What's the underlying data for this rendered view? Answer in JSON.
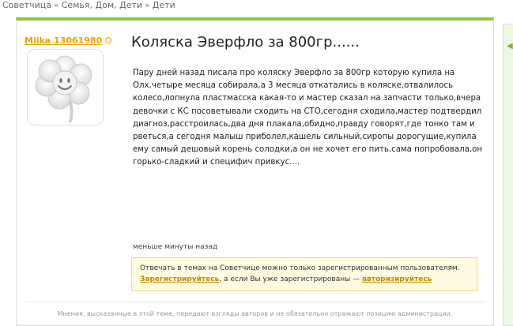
{
  "breadcrumb": {
    "items": [
      "Советчица",
      "Семья, Дом, Дети",
      "Дети"
    ],
    "separator": "»"
  },
  "post": {
    "author": "Milka 13061980",
    "title": "Коляска Эверфло за 800гр......",
    "body": "Пару дней назад писала про коляску Эверфло за 800гр которую купила на Олх,четыре месяца собирала,а 3 месяца откатались в коляске,отвалилось колесо,лопнула пластмасска какая-то и мастер сказал на запчасти только,вчера девочки с КС посоветывали сходить на СТО,сегодня сходила,мастер подтвердил диагноз,расстроилась,два дня плакала,обидно,правду говорят,где тонко там и рветься,а сегодня малыш приболел,кашель сильный,сиропы дорогущие,купила ему самый дешовый корень солодки,а он не хочет его пить,сама попробовала,он горько-сладкий и специфич привкус....",
    "time": "меньше минуты назад"
  },
  "notice": {
    "text_1": "Отвечать в темах на Советчице можно только зарегистрированным пользователям.",
    "register_link": "Зарегистрируйтесь",
    "text_2": ", а если Вы уже зарегистрированы — ",
    "login_link": "авторизируйтесь"
  },
  "disclaimer": "Мнения, высказанные в этой теме, передают взгляды авторов и не обязательно отражают позицию администрации.",
  "colors": {
    "accent_green": "#8cc63f",
    "author_orange": "#e8a200",
    "notice_bg": "#fffbe0"
  },
  "icons": {
    "avatar": "flower-smiley-icon",
    "online": "online-status-icon",
    "side_arrow": "chevron-left-icon"
  }
}
